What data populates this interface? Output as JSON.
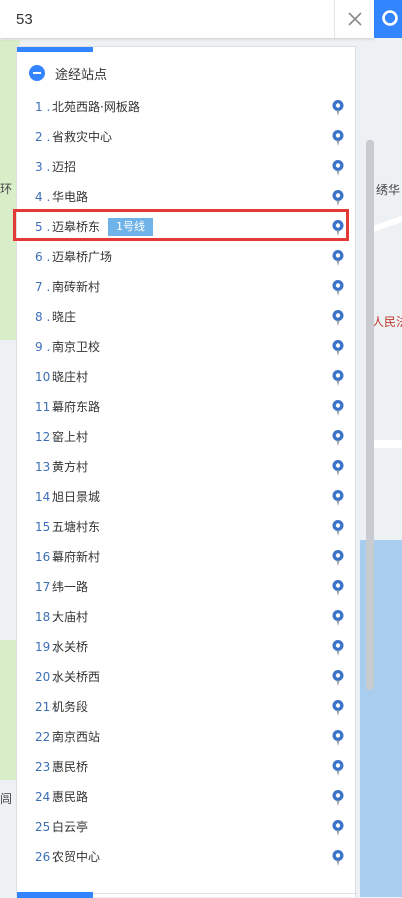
{
  "search": {
    "value": "53",
    "placeholder": ""
  },
  "map_labels": {
    "lbl_xiuhua": "绣华",
    "lbl_renmin": "人民法",
    "lbl_edge1": "环",
    "lbl_edge2": "闾"
  },
  "panel": {
    "stops_title": "途经站点",
    "highlight_index": 5,
    "line_badge": "1号线",
    "stops": [
      {
        "num": "1 .",
        "name": "北苑西路·网板路"
      },
      {
        "num": "2 .",
        "name": "省救灾中心"
      },
      {
        "num": "3 .",
        "name": "迈招"
      },
      {
        "num": "4 .",
        "name": "华电路"
      },
      {
        "num": "5 .",
        "name": "迈皋桥东"
      },
      {
        "num": "6 .",
        "name": "迈皋桥广场"
      },
      {
        "num": "7 .",
        "name": "南砖新村"
      },
      {
        "num": "8 .",
        "name": "晓庄"
      },
      {
        "num": "9 .",
        "name": "南京卫校"
      },
      {
        "num": "10 .",
        "name": "晓庄村"
      },
      {
        "num": "11 .",
        "name": "幕府东路"
      },
      {
        "num": "12 .",
        "name": "窑上村"
      },
      {
        "num": "13 .",
        "name": "黄方村"
      },
      {
        "num": "14 .",
        "name": "旭日景城"
      },
      {
        "num": "15 .",
        "name": "五塘村东"
      },
      {
        "num": "16 .",
        "name": "幕府新村"
      },
      {
        "num": "17 .",
        "name": "纬一路"
      },
      {
        "num": "18 .",
        "name": "大庙村"
      },
      {
        "num": "19 .",
        "name": "水关桥"
      },
      {
        "num": "20 .",
        "name": "水关桥西"
      },
      {
        "num": "21 .",
        "name": "机务段"
      },
      {
        "num": "22 .",
        "name": "南京西站"
      },
      {
        "num": "23 .",
        "name": "惠民桥"
      },
      {
        "num": "24 .",
        "name": "惠民路"
      },
      {
        "num": "25 .",
        "name": "白云亭"
      },
      {
        "num": "26 .",
        "name": "农贸中心"
      }
    ]
  },
  "colors": {
    "accent": "#3385ff",
    "highlight": "#e53935",
    "badge": "#6fb3e8"
  }
}
